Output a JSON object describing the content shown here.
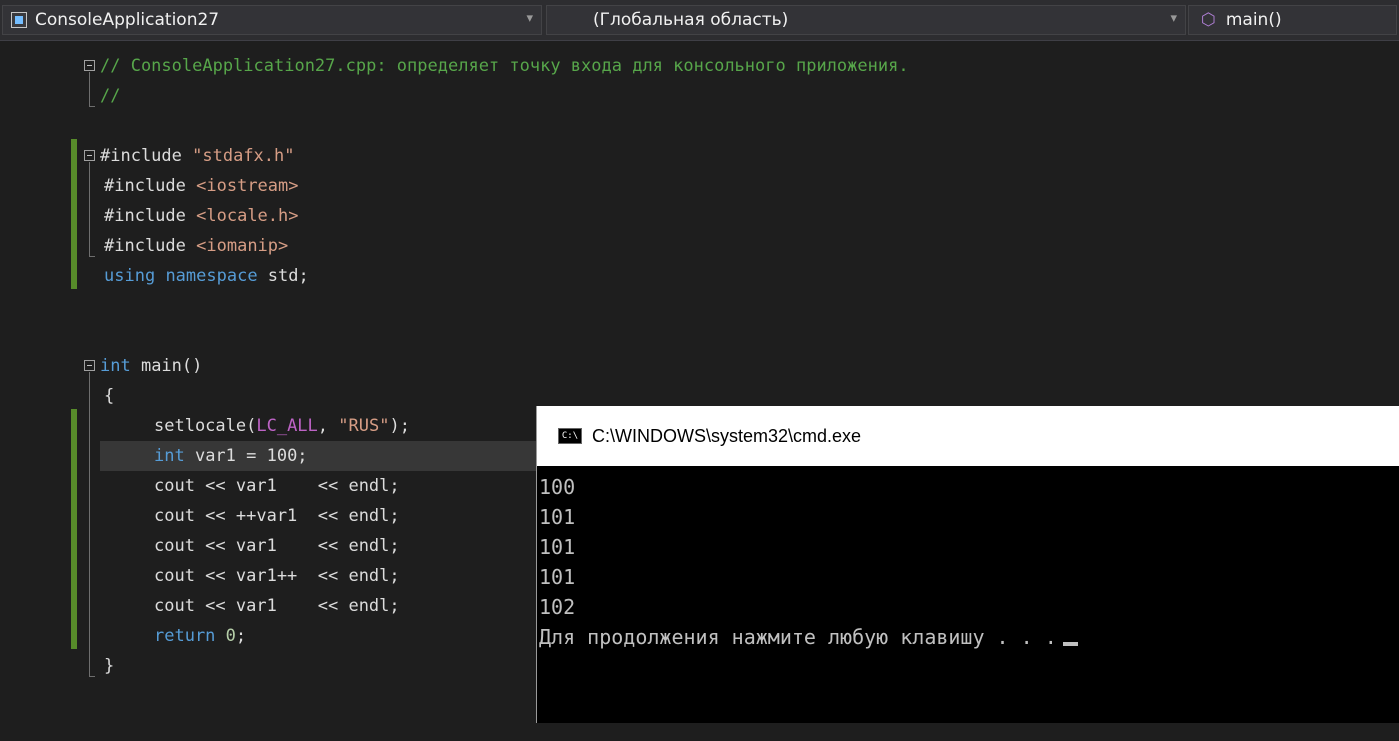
{
  "navbar": {
    "project": "ConsoleApplication27",
    "scope": "(Глобальная область)",
    "member": "main()",
    "icons": {
      "project": "cpp-project-icon",
      "member": "method-icon",
      "dropdown": "chevron-down-icon"
    }
  },
  "code": {
    "l1_comment": "// ConsoleApplication27.cpp: определяет точку входа для консольного приложения.",
    "l2_comment": "//",
    "inc1_kw": "#include",
    "inc1_str": "\"stdafx.h\"",
    "inc2_kw": "#include",
    "inc2_str": "<iostream>",
    "inc3_kw": "#include",
    "inc3_str": "<locale.h>",
    "inc4_kw": "#include",
    "inc4_str": "<iomanip>",
    "using_kw1": "using",
    "using_kw2": "namespace",
    "using_rest": " std;",
    "main_kw": "int",
    "main_rest": " main()",
    "open_brace": "{",
    "setlocale_fn": "setlocale(",
    "setlocale_macro": "LC_ALL",
    "setlocale_sep": ", ",
    "setlocale_str": "\"RUS\"",
    "setlocale_end": ");",
    "decl_kw": "int",
    "decl_rest": " var1 = 100;",
    "cout1": "cout << var1    << endl;",
    "cout2": "cout << ++var1  << endl;",
    "cout3": "cout << var1    << endl;",
    "cout4": "cout << var1++  << endl;",
    "cout5": "cout << var1    << endl;",
    "return_kw": "return",
    "return_num": " 0",
    "return_end": ";",
    "close_brace": "}"
  },
  "console": {
    "title": "C:\\WINDOWS\\system32\\cmd.exe",
    "icon_label": "C:\\",
    "output": [
      "100",
      "101",
      "101",
      "101",
      "102"
    ],
    "prompt": "Для продолжения нажмите любую клавишу . . ."
  }
}
